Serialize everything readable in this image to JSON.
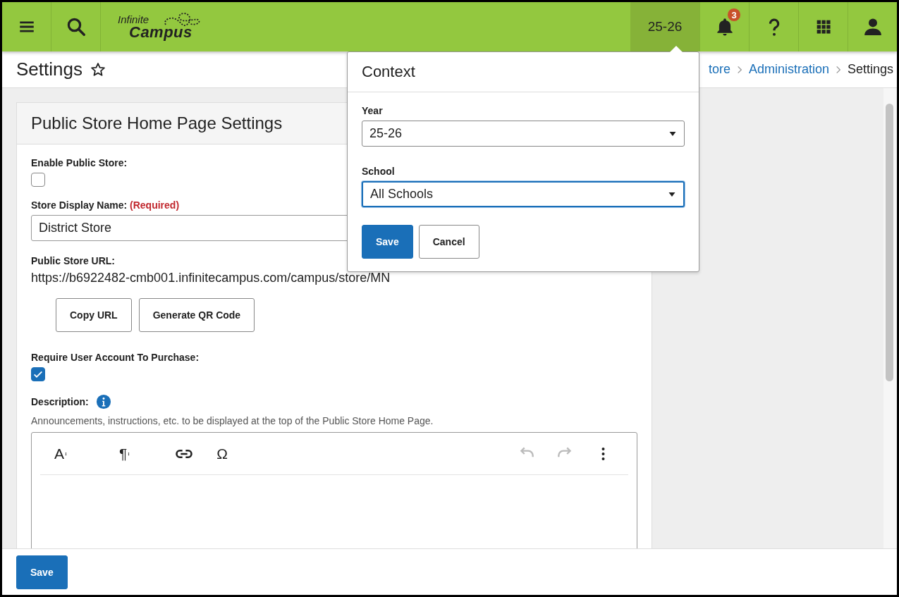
{
  "top_bar": {
    "logo": {
      "line1": "Infinite",
      "line2": "Campus"
    },
    "context_button": {
      "label": "25-26",
      "selected": true
    },
    "notifications": {
      "count": "3"
    }
  },
  "page_header": {
    "title": "Settings",
    "favorite": false,
    "breadcrumbs": [
      {
        "label": "tore",
        "link": true
      },
      {
        "label": "Administration",
        "link": true
      },
      {
        "label": "Settings",
        "link": false
      }
    ]
  },
  "panel": {
    "title": "Public Store Home Page Settings",
    "enable_store": {
      "label": "Enable Public Store:",
      "checked": false
    },
    "display_name": {
      "label": "Store Display Name:",
      "required": "(Required)",
      "value": "District Store"
    },
    "url": {
      "label": "Public Store URL:",
      "value": "https://b6922482-cmb001.infinitecampus.com/campus/store/MN",
      "buttons": [
        "Copy URL",
        "Generate QR Code"
      ]
    },
    "require_account": {
      "label": "Require User Account To Purchase:",
      "checked": true
    },
    "description": {
      "label": "Description:",
      "hint": "Announcements, instructions, etc. to be displayed at the top of the Public Store Home Page.",
      "toolbar": [
        {
          "kind": "glyph",
          "text": "A",
          "menu": true
        },
        {
          "kind": "glyph",
          "text": "¶",
          "menu": true
        },
        {
          "kind": "link",
          "disabled": false
        },
        {
          "kind": "glyph",
          "text": "Ω",
          "menu": false
        },
        {
          "kind": "spacer"
        },
        {
          "kind": "undo",
          "disabled": true
        },
        {
          "kind": "redo",
          "disabled": true
        },
        {
          "kind": "more",
          "disabled": false
        }
      ]
    }
  },
  "context_popup": {
    "title": "Context",
    "fields": [
      {
        "label": "Year",
        "value": "25-26",
        "focused": false
      },
      {
        "label": "School",
        "value": "All Schools",
        "focused": true
      }
    ],
    "buttons": [
      {
        "label": "Save",
        "primary": true
      },
      {
        "label": "Cancel",
        "primary": false
      }
    ]
  },
  "footer": {
    "save_button": "Save"
  }
}
